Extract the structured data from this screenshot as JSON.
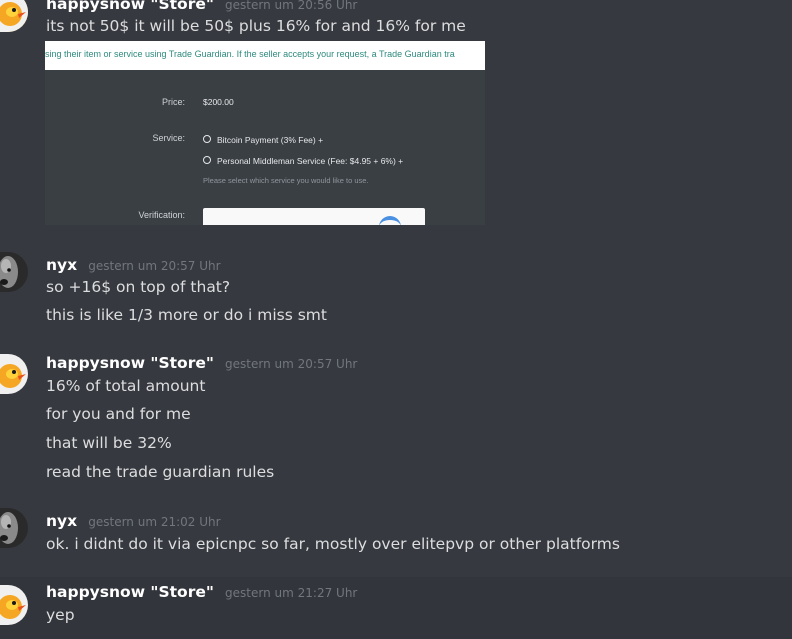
{
  "messages": [
    {
      "author": "happysnow \"Store\"",
      "timestamp": "gestern um 20:56 Uhr",
      "lines": [
        "its not 50$ it will be 50$ plus 16% for and 16% for me"
      ]
    },
    {
      "author": "nyx",
      "timestamp": "gestern um 20:57 Uhr",
      "lines": [
        "so +16$ on top of that?",
        "this is like 1/3 more or do i miss smt"
      ]
    },
    {
      "author": "happysnow \"Store\"",
      "timestamp": "gestern um 20:57 Uhr",
      "lines": [
        "16% of total amount",
        "for you and for me",
        "that will be 32%",
        "read the trade guardian rules"
      ]
    },
    {
      "author": "nyx",
      "timestamp": "gestern um 21:02 Uhr",
      "lines": [
        "ok. i didnt do it via epicnpc so far, mostly over elitepvp or other platforms"
      ]
    },
    {
      "author": "happysnow \"Store\"",
      "timestamp": "gestern um 21:27 Uhr",
      "lines": [
        "yep"
      ]
    }
  ],
  "embed": {
    "notice": "sing their item or service using Trade Guardian. If the seller accepts your request, a Trade Guardian tra",
    "price_label": "Price:",
    "price_value": "$200.00",
    "service_label": "Service:",
    "service_option_1": "Bitcoin Payment (3% Fee)  +",
    "service_option_2": "Personal Middleman Service (Fee: $4.95 + 6%)  +",
    "service_hint": "Please select which service you would like to use.",
    "verification_label": "Verification:"
  },
  "colors": {
    "background": "#36393f",
    "highlight": "#32353b",
    "username": "#ffffff",
    "timestamp": "#72767d",
    "text": "#dcddde"
  },
  "icons": {
    "happysnow_avatar": "orange-bird-avatar-icon",
    "nyx_avatar": "grey-dog-avatar-icon"
  }
}
